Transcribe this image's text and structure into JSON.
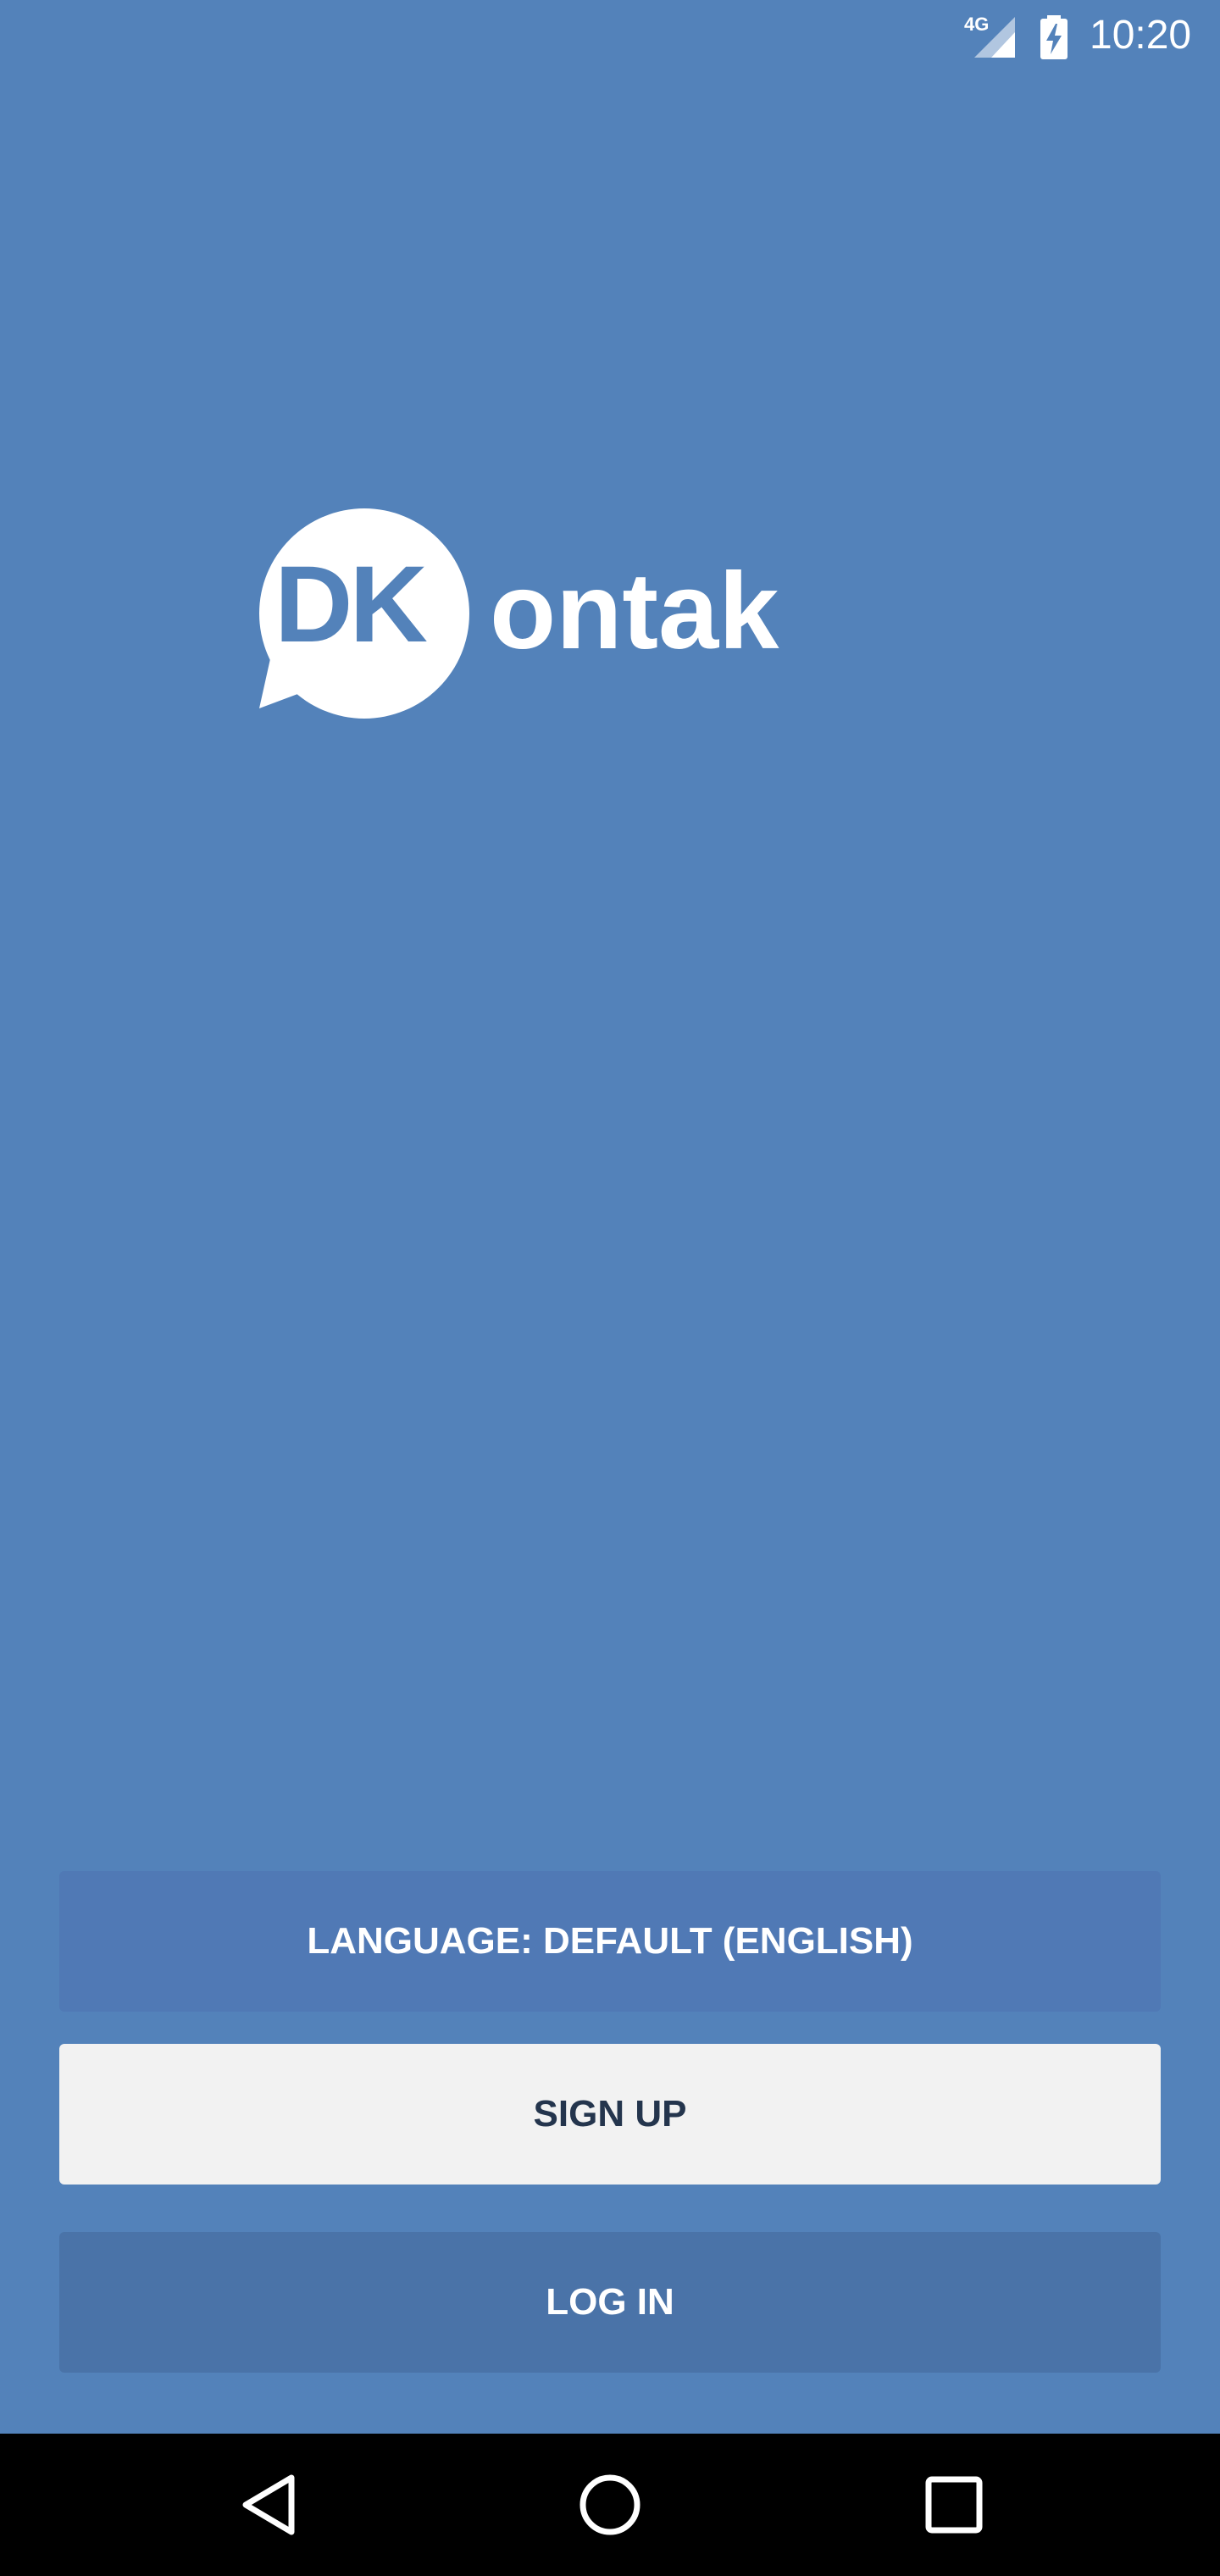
{
  "status_bar": {
    "network_type": "4G",
    "time": "10:20",
    "icons": [
      "signal-icon",
      "battery-charging-icon"
    ]
  },
  "logo": {
    "mark_text": "DK",
    "word_text": "ontak",
    "mark_color": "#ffffff",
    "mark_text_color": "#5382BA"
  },
  "buttons": {
    "language_label": "LANGUAGE: DEFAULT (ENGLISH)",
    "signup_label": "SIGN UP",
    "login_label": "LOG IN"
  },
  "nav_bar": {
    "icons": [
      "back-icon",
      "home-icon",
      "recents-icon"
    ]
  },
  "colors": {
    "background": "#5382BA",
    "signup_bg": "#F2F2F2",
    "signup_text": "#24354D",
    "login_bg": "#4A73A8",
    "nav_bg": "#000000"
  }
}
